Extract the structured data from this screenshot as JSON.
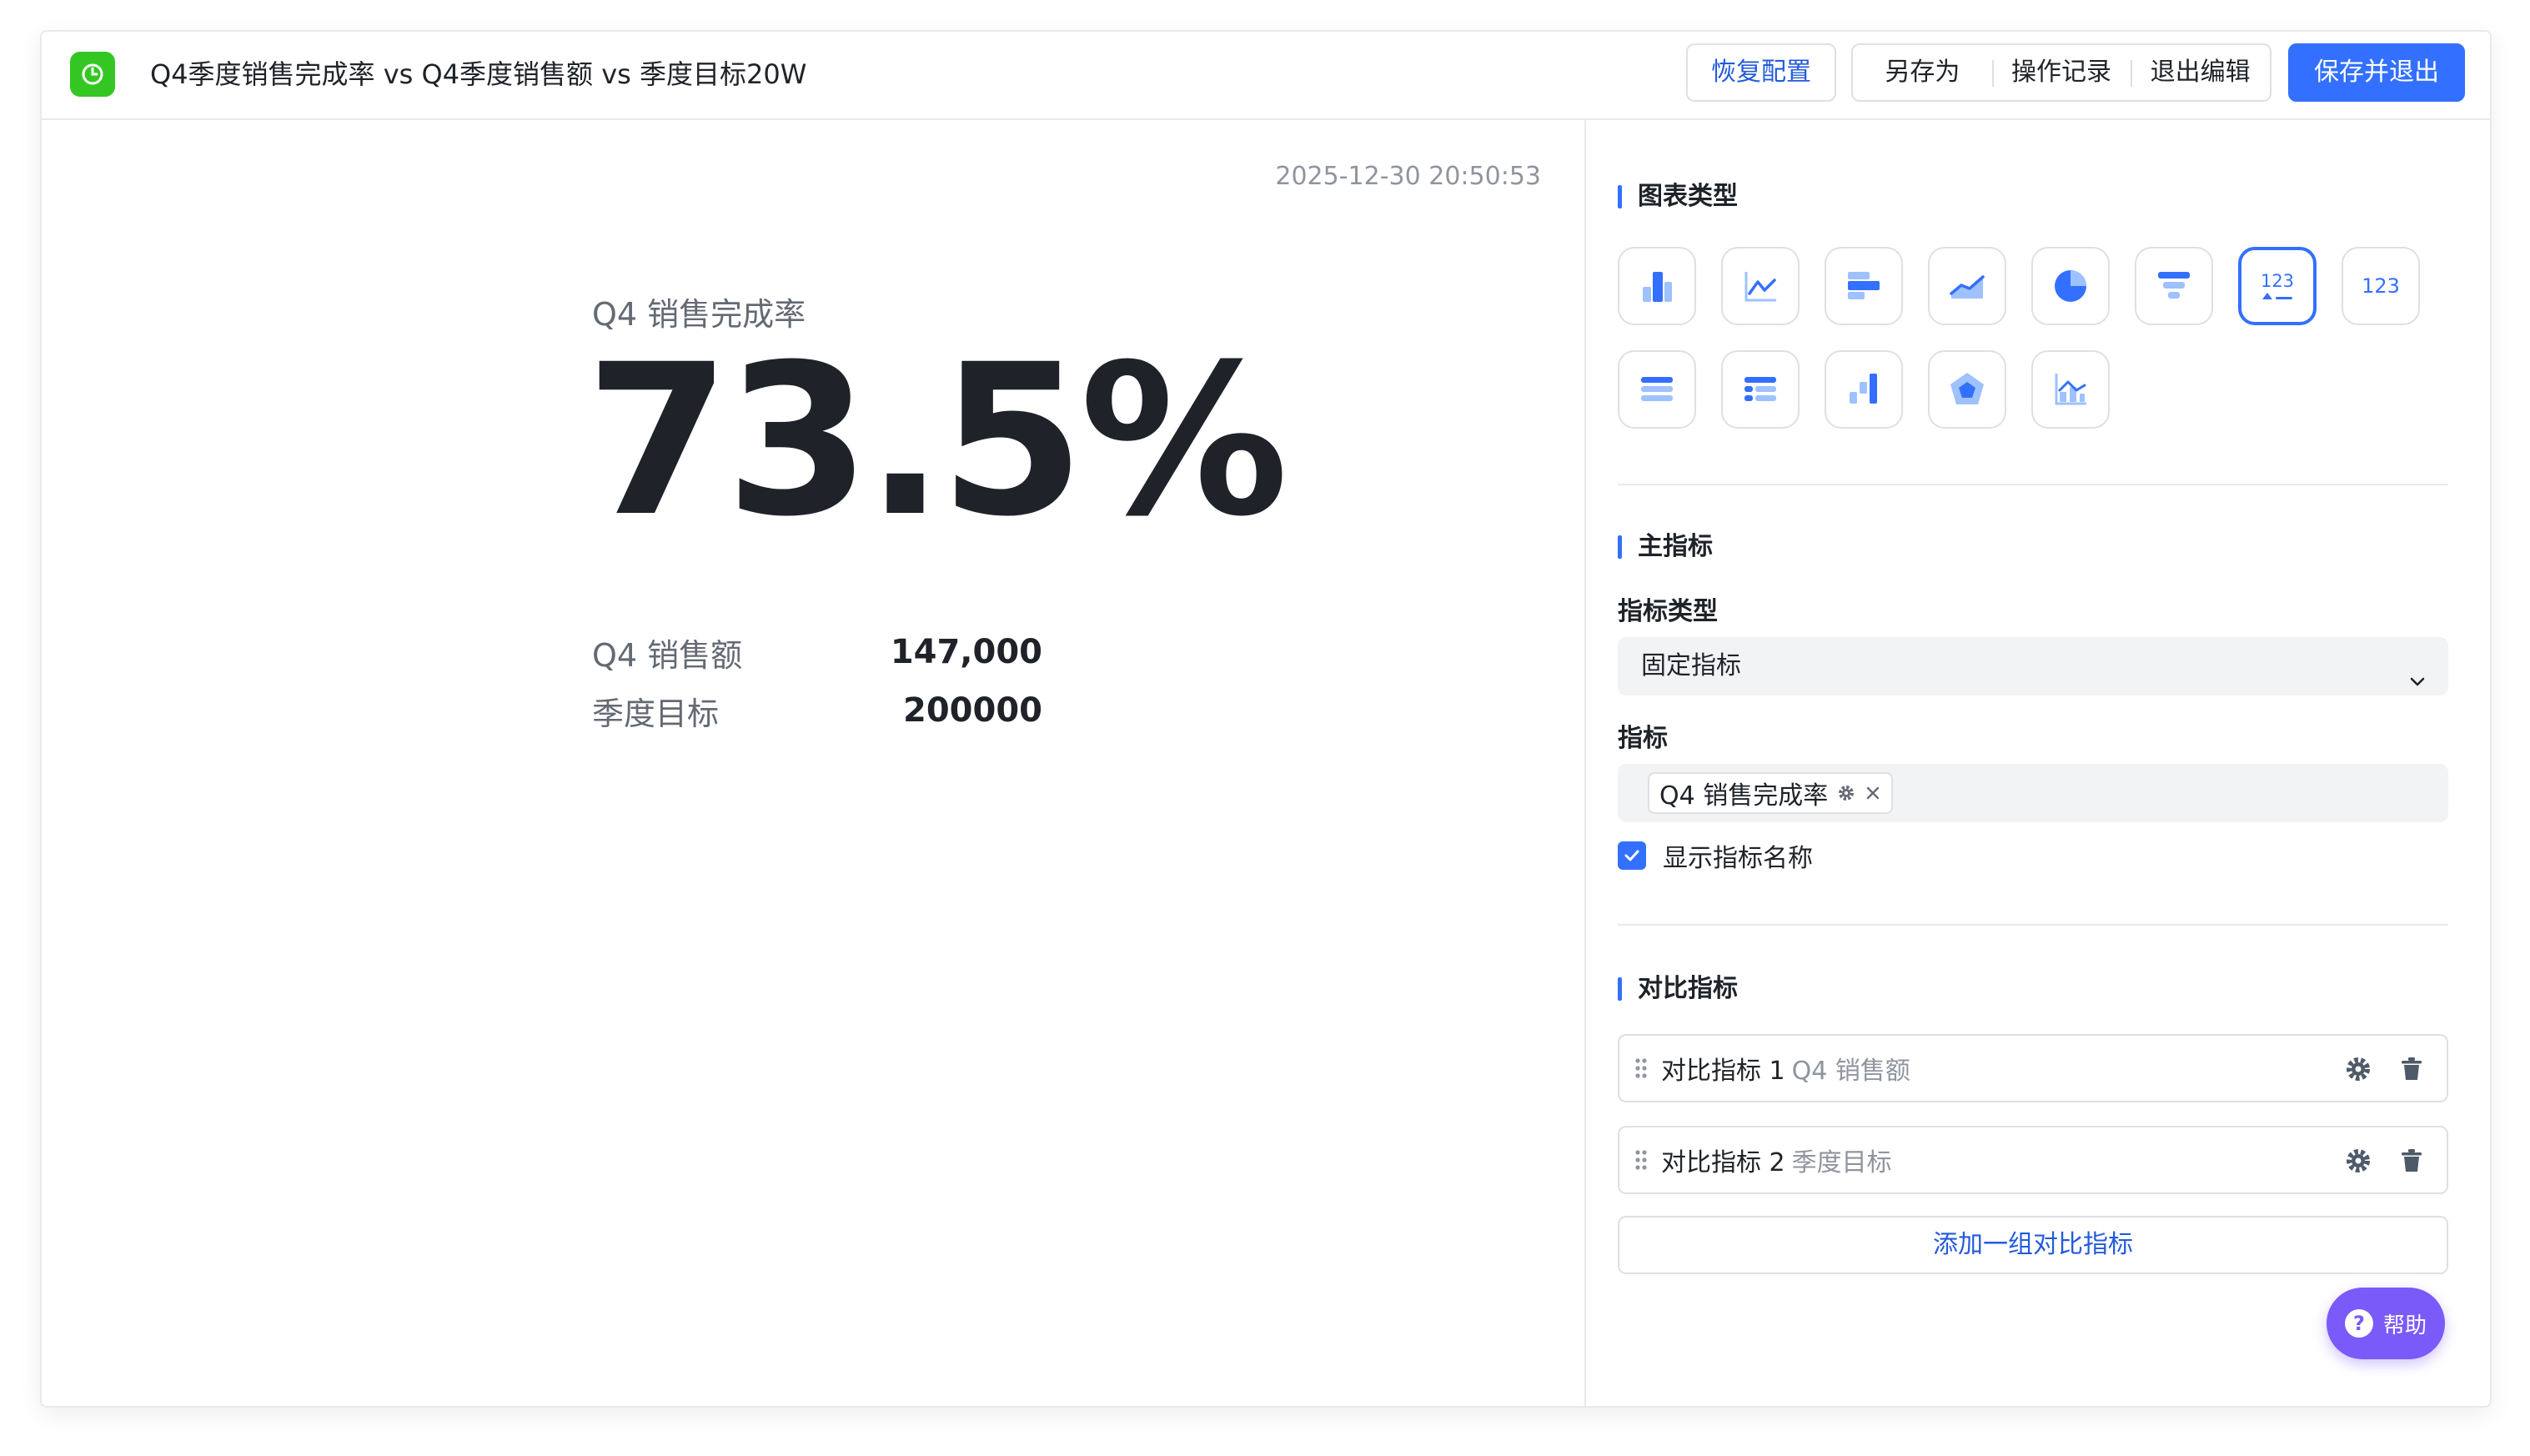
{
  "header": {
    "title": "Q4季度销售完成率 vs Q4季度销售额 vs 季度目标20W",
    "restore_label": "恢复配置",
    "save_as_label": "另存为",
    "history_label": "操作记录",
    "exit_edit_label": "退出编辑",
    "save_exit_label": "保存并退出"
  },
  "canvas": {
    "timestamp": "2025-12-30 20:50:53",
    "metric_name": "Q4 销售完成率",
    "metric_value": "73.5%",
    "comparisons": [
      {
        "label": "Q4 销售额",
        "value": "147,000"
      },
      {
        "label": "季度目标",
        "value": "200000"
      }
    ]
  },
  "panel": {
    "chart_type_title": "图表类型",
    "chart_types": [
      {
        "icon": "bar-chart-icon"
      },
      {
        "icon": "line-chart-icon"
      },
      {
        "icon": "horizontal-bar-icon"
      },
      {
        "icon": "area-chart-icon"
      },
      {
        "icon": "pie-chart-icon"
      },
      {
        "icon": "funnel-chart-icon"
      },
      {
        "icon": "metric-card-trend-icon",
        "label": "123",
        "selected": true
      },
      {
        "icon": "metric-card-icon",
        "label": "123"
      },
      {
        "icon": "table-icon"
      },
      {
        "icon": "pivot-table-icon"
      },
      {
        "icon": "waterfall-chart-icon"
      },
      {
        "icon": "radar-chart-icon"
      },
      {
        "icon": "combo-chart-icon"
      }
    ],
    "main_metric_title": "主指标",
    "metric_type_label": "指标类型",
    "metric_type_value": "固定指标",
    "metric_label": "指标",
    "metric_tag": "Q4 销售完成率",
    "show_name_label": "显示指标名称",
    "show_name_checked": true,
    "compare_title": "对比指标",
    "compare_items": [
      {
        "name": "对比指标 1",
        "metric": "Q4 销售额"
      },
      {
        "name": "对比指标 2",
        "metric": "季度目标"
      }
    ],
    "add_compare_label": "添加一组对比指标"
  },
  "help": {
    "label": "帮助"
  },
  "colors": {
    "accent": "#3370ff",
    "app_logo": "#34c724",
    "help": "#7a5af8"
  }
}
